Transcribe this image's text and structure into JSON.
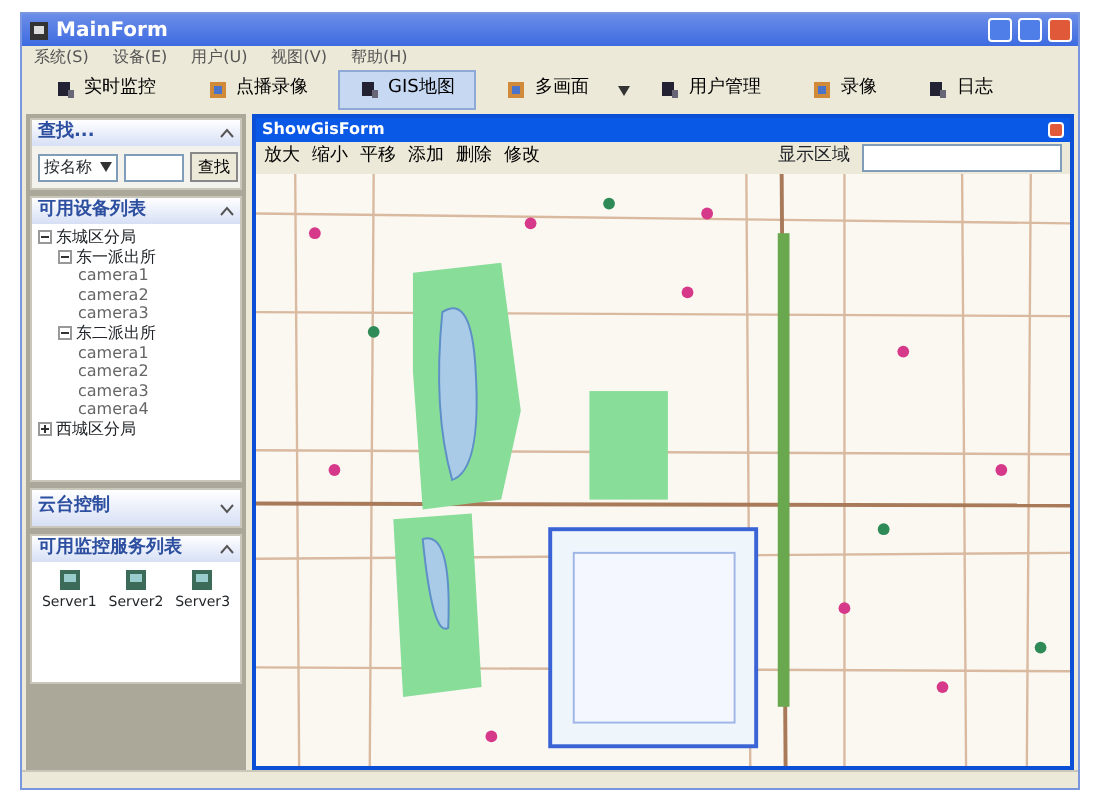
{
  "window": {
    "title": "MainForm"
  },
  "menu": [
    "系统(S)",
    "设备(E)",
    "用户(U)",
    "视图(V)",
    "帮助(H)"
  ],
  "toolbar": [
    {
      "label": "实时监控",
      "selected": false,
      "dropdown": false
    },
    {
      "label": "点播录像",
      "selected": false,
      "dropdown": false
    },
    {
      "label": "GIS地图",
      "selected": true,
      "dropdown": false
    },
    {
      "label": "多画面",
      "selected": false,
      "dropdown": true
    },
    {
      "label": "用户管理",
      "selected": false,
      "dropdown": false
    },
    {
      "label": "录像",
      "selected": false,
      "dropdown": false
    },
    {
      "label": "日志",
      "selected": false,
      "dropdown": false
    }
  ],
  "search_panel": {
    "title": "查找...",
    "mode": "按名称",
    "button": "查找"
  },
  "device_panel": {
    "title": "可用设备列表",
    "tree": [
      {
        "label": "东城区分局",
        "expanded": true,
        "children": [
          {
            "label": "东一派出所",
            "expanded": true,
            "children": [
              {
                "label": "camera1"
              },
              {
                "label": "camera2"
              },
              {
                "label": "camera3"
              }
            ]
          },
          {
            "label": "东二派出所",
            "expanded": true,
            "children": [
              {
                "label": "camera1"
              },
              {
                "label": "camera2"
              },
              {
                "label": "camera3"
              },
              {
                "label": "camera4"
              }
            ]
          }
        ]
      },
      {
        "label": "西城区分局",
        "expanded": false
      }
    ]
  },
  "ptz_panel": {
    "title": "云台控制"
  },
  "server_panel": {
    "title": "可用监控服务列表",
    "servers": [
      "Server1",
      "Server2",
      "Server3"
    ]
  },
  "gis_window": {
    "title": "ShowGisForm",
    "tools": [
      "放大",
      "缩小",
      "平移",
      "添加",
      "删除",
      "修改"
    ],
    "area_label": "显示区域"
  }
}
